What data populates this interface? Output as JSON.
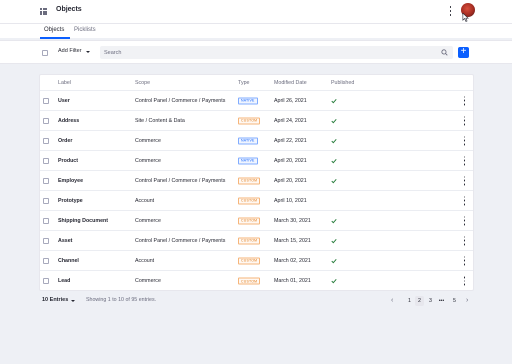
{
  "appbar": {
    "title": "Objects",
    "apps_icon": "apps-grid-icon",
    "menu_icon": "vertical-ellipsis-icon",
    "avatar": "user-avatar"
  },
  "tabs": [
    {
      "label": "Objects",
      "active": true
    },
    {
      "label": "Picklists",
      "active": false
    }
  ],
  "toolbar": {
    "add_filter_label": "Add Filter",
    "search_placeholder": "Search",
    "add_button_label": "+",
    "search_icon": "search-icon"
  },
  "table": {
    "headers": [
      "Label",
      "Scope",
      "Type",
      "Modified Date",
      "Published"
    ],
    "rows": [
      {
        "label": "User",
        "scope": "Control Panel / Commerce / Payments",
        "type": "NATIVE",
        "modified": "April 26, 2021",
        "published": true
      },
      {
        "label": "Address",
        "scope": "Site / Content & Data",
        "type": "CUSTOM",
        "modified": "April 24, 2021",
        "published": true
      },
      {
        "label": "Order",
        "scope": "Commerce",
        "type": "NATIVE",
        "modified": "April 22, 2021",
        "published": true
      },
      {
        "label": "Product",
        "scope": "Commerce",
        "type": "NATIVE",
        "modified": "April 20, 2021",
        "published": true
      },
      {
        "label": "Employee",
        "scope": "Control Panel / Commerce / Payments",
        "type": "CUSTOM",
        "modified": "April 20, 2021",
        "published": true
      },
      {
        "label": "Prototype",
        "scope": "Account",
        "type": "CUSTOM",
        "modified": "April 10, 2021",
        "published": false
      },
      {
        "label": "Shipping Document",
        "scope": "Commerce",
        "type": "CUSTOM",
        "modified": "March 30, 2021",
        "published": true
      },
      {
        "label": "Asset",
        "scope": "Control Panel / Commerce / Payments",
        "type": "CUSTOM",
        "modified": "March 15, 2021",
        "published": true
      },
      {
        "label": "Channel",
        "scope": "Account",
        "type": "CUSTOM",
        "modified": "March 02, 2021",
        "published": true
      },
      {
        "label": "Lead",
        "scope": "Commerce",
        "type": "CUSTOM",
        "modified": "March 01, 2021",
        "published": true
      }
    ]
  },
  "pagination": {
    "entries_label": "10 Entries",
    "info": "Showing 1 to 10 of 95 entries.",
    "pages": [
      "1",
      "2",
      "3",
      "•••",
      "5"
    ],
    "current_page": "2",
    "prev_icon": "chevron-left-icon",
    "next_icon": "chevron-right-icon"
  },
  "colors": {
    "accent": "#0b5fff",
    "native_badge": "#0b5fff",
    "custom_badge": "#e07a16",
    "published_check": "#287d3c",
    "background": "#eef0f5"
  }
}
